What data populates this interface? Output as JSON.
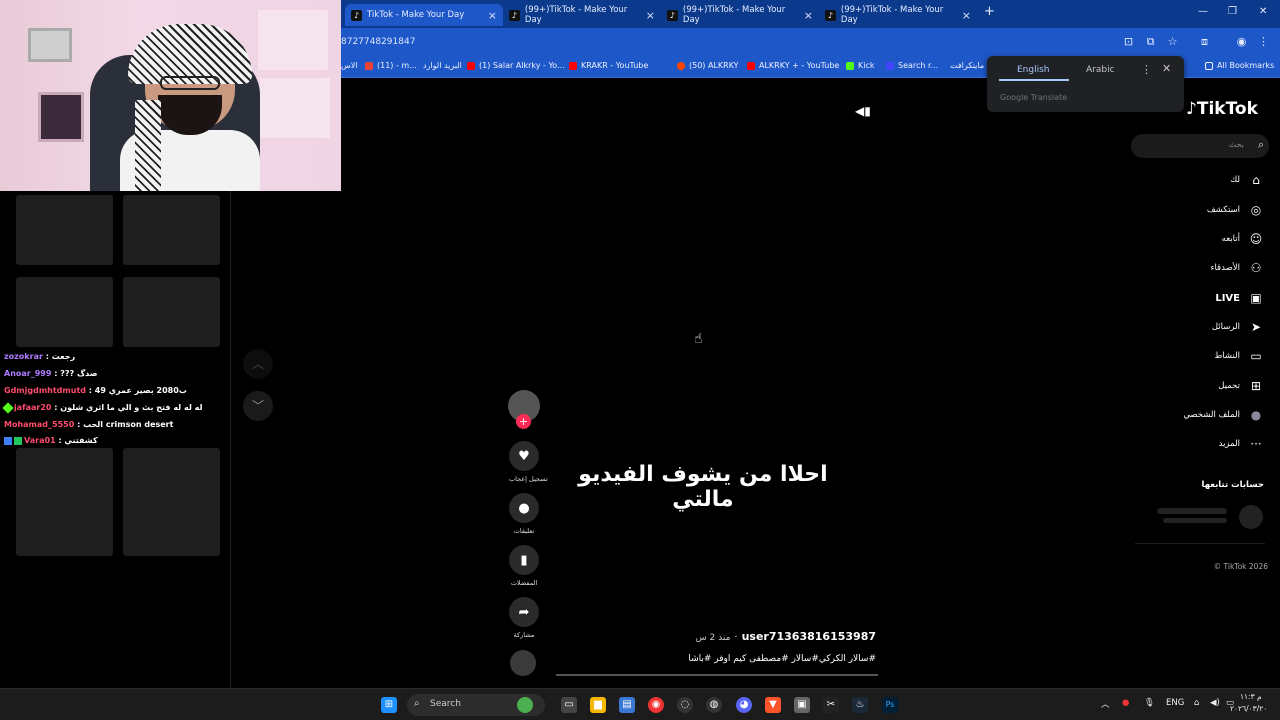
{
  "browser": {
    "tabs": [
      {
        "label": "TikTok - Make Your Day",
        "active": true
      },
      {
        "label": "(99+)TikTok - Make Your Day",
        "active": false
      },
      {
        "label": "(99+)TikTok - Make Your Day",
        "active": false
      },
      {
        "label": "(99+)TikTok - Make Your Day",
        "active": false
      }
    ],
    "new_tab": "+",
    "url_fragment": "8727748291847",
    "bookmarks": [
      {
        "label": "الاس",
        "color": "#777"
      },
      {
        "label": "(11) - m...",
        "color": "#ea4335"
      },
      {
        "label": "البريد الوارد",
        "color": "#ea4335"
      },
      {
        "label": "(1) Salar Alkrky - Yo...",
        "color": "#ff0000"
      },
      {
        "label": "KRAKR - YouTube",
        "color": "#ff0000"
      },
      {
        "label": "(50) ALKRKY",
        "color": "#ff4500"
      },
      {
        "label": "ALKRKY + - YouTube",
        "color": "#ff0000"
      },
      {
        "label": "Kick",
        "color": "#53fc18"
      },
      {
        "label": "Search r...",
        "color": "#4444ff"
      },
      {
        "label": "ماينكرافت -",
        "color": "#777"
      }
    ],
    "all_bookmarks": "All Bookmarks"
  },
  "translate": {
    "lang_a": "English",
    "lang_b": "Arabic",
    "footer": "Google Translate"
  },
  "chat": [
    {
      "user": "zozokrar",
      "user_color": "#b07cff",
      "msg": ": رجعت"
    },
    {
      "user": "Anoar_999",
      "user_color": "#b07cff",
      "msg": ": ??? صدگ"
    },
    {
      "user": "Gdmjgdmhtdmutd",
      "user_color": "#ff4d6d",
      "msg": ": ب2080 بصير عمري 49"
    },
    {
      "user": "jafaar20",
      "user_color": "#ff4d6d",
      "msg": ": له له له فتح بث و الي ما اثري شلون"
    },
    {
      "user": "Mohamad_5550",
      "user_color": "#ff4d6d",
      "msg": ": الحب crimson desert"
    },
    {
      "user": "Vara01",
      "user_color": "#ff4d6d",
      "msg": ": كشفتني"
    }
  ],
  "video": {
    "caption": "احلاا من يشوف الفيديو مالتي",
    "username": "user71363816153987",
    "time_ago": "منذ 2 س",
    "separator": "·",
    "description": "#سالار الكركي#سالار #مصطفى كيم اوفر #باشا",
    "actions": [
      {
        "label": "تسجيل إعجاب",
        "icon": "♥"
      },
      {
        "label": "تعليقات",
        "icon": "●"
      },
      {
        "label": "المفضلات",
        "icon": "▮"
      },
      {
        "label": "مشاركة",
        "icon": "➦"
      }
    ]
  },
  "sidebar": {
    "logo": "TikTok",
    "search_placeholder": "بحث",
    "items": [
      {
        "label": "لك",
        "icon": "⌂"
      },
      {
        "label": "استكشف",
        "icon": "◎"
      },
      {
        "label": "أتابعه",
        "icon": "☺"
      },
      {
        "label": "الأصدقاء",
        "icon": "⚇"
      },
      {
        "label": "LIVE",
        "icon": "▣"
      },
      {
        "label": "الرسائل",
        "icon": "➤"
      },
      {
        "label": "النشاط",
        "icon": "▭"
      },
      {
        "label": "تحميل",
        "icon": "⊞"
      },
      {
        "label": "الملف الشخصي",
        "icon": "●"
      },
      {
        "label": "المزيد",
        "icon": "···"
      }
    ],
    "following_title": "حسابات تتابعها",
    "copyright": "© TikTok 2026"
  },
  "taskbar": {
    "search_label": "Search",
    "lang": "ENG",
    "time": "م ١١:٣",
    "date": "٢٠٢٦/٠٣/٢٠"
  }
}
